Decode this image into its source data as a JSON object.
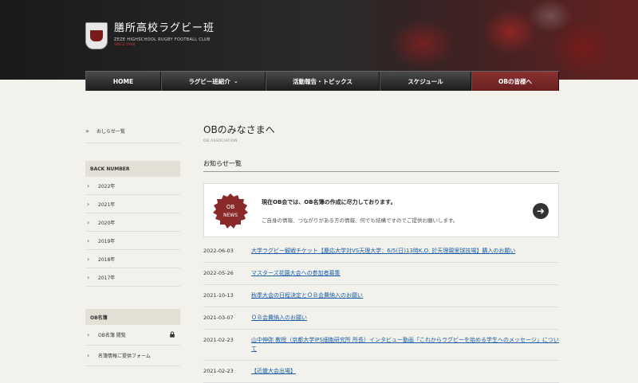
{
  "header": {
    "title": "膳所高校ラグビー班",
    "subtitle": "ZEZE HIGHSCHOOL RUGBY FOOTBALL CLUB",
    "subtitle2": "SINCE 1948"
  },
  "nav": [
    {
      "label": "HOME"
    },
    {
      "label": "ラグビー班紹介",
      "dropdown": true
    },
    {
      "label": "活動報告・トピックス"
    },
    {
      "label": "スケジュール"
    },
    {
      "label": "OBの皆様へ",
      "active": true
    }
  ],
  "sidebar": {
    "top_link": "おしらせ一覧",
    "back_number_heading": "BACK NUMBER",
    "years": [
      "2022年",
      "2021年",
      "2020年",
      "2019年",
      "2018年",
      "2017年"
    ],
    "ob_heading": "OB名簿",
    "ob_links": [
      {
        "label": "OB名簿 閲覧",
        "locked": true
      },
      {
        "label": "名簿情報ご提供フォーム"
      }
    ]
  },
  "main": {
    "title": "OBのみなさまへ",
    "subtitle": "OB ASSOCIATION",
    "section_title": "お知らせ一覧",
    "notice": {
      "badge_line1": "OB",
      "badge_line2": "NEWS",
      "title": "現在OB会では、OB名簿の作成に尽力しております。",
      "text": "ご自身の情報、つながりがある方の情報、何でも結構ですのでご提供お願いします。"
    },
    "news": [
      {
        "date": "2022-06-03",
        "title": "大学ラグビー観戦チケット【慶応大学対VS天理大学：6/5(日)13時K.O. 於天理親里球技場】購入のお願い"
      },
      {
        "date": "2022-05-26",
        "title": "マスターズ花園大会への参加者募集"
      },
      {
        "date": "2021-10-13",
        "title": "秋季大会の日程決定とＯＢ会費納入のお願い"
      },
      {
        "date": "2021-03-07",
        "title": "ＯＢ会費納入のお願い"
      },
      {
        "date": "2021-02-23",
        "title": "山中伸弥 教授（京都大学iPS細胞研究所 所長）インタビュー動画「これからラグビーを始める学生へのメッセージ」について"
      },
      {
        "date": "2021-02-23",
        "title": "【近畿大会出場】"
      }
    ]
  },
  "colors": {
    "accent": "#7a2424",
    "link": "#1a5fa8",
    "nav_bg": "#222222",
    "page_bg": "#f3f1ec"
  }
}
